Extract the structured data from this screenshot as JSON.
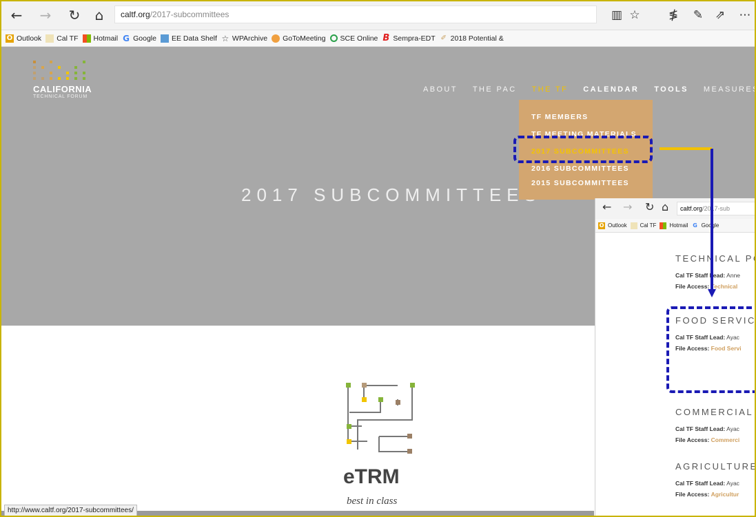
{
  "browser": {
    "url_host": "caltf.org",
    "url_path": "/2017-subcommittees",
    "icons": [
      "back-arrow-icon",
      "forward-arrow-icon",
      "refresh-icon",
      "home-icon",
      "reading-view-icon",
      "favorite-star-icon",
      "favorites-list-icon",
      "pen-icon",
      "share-icon",
      "more-icon"
    ]
  },
  "favorites": [
    "Outlook",
    "Cal TF",
    "Hotmail",
    "Google",
    "EE Data Shelf",
    "WPArchive",
    "GoToMeeting",
    "SCE Online",
    "Sempra-EDT",
    "2018 Potential &"
  ],
  "site": {
    "logo_name": "CALIFORNIA",
    "logo_sub": "TECHNICAL FORUM",
    "menu": [
      "ABOUT",
      "THE PAC",
      "THE TF",
      "CALENDAR",
      "TOOLS",
      "MEASURES"
    ],
    "dropdown": [
      "TF MEMBERS",
      "TF MEETING MATERIALS",
      "2017 SUBCOMMITTEES",
      "2016 SUBCOMMITTEES",
      "2015 SUBCOMMITTEES"
    ],
    "hero_title": "2017 SUBCOMMITTEES",
    "etrm_title": "eTRM",
    "etrm_tagline": "best in class"
  },
  "status_url": "http://www.caltf.org/2017-subcommittees/",
  "inset": {
    "url_host": "caltf.org",
    "url_path": "/2017-sub",
    "favorites": [
      "Outlook",
      "Cal TF",
      "Hotmail",
      "Google"
    ],
    "sections": [
      {
        "heading": "TECHNICAL PO",
        "lead_label": "Cal TF Staff Lead:",
        "lead_value": "Anne",
        "access_label": "File Access:",
        "access_value": "Technical"
      },
      {
        "heading": "FOOD SERVICE",
        "lead_label": "Cal TF Staff Lead:",
        "lead_value": "Ayac",
        "access_label": "File Access:",
        "access_value": "Food Servi"
      },
      {
        "heading": "COMMERCIAL",
        "lead_label": "Cal TF Staff Lead:",
        "lead_value": "Ayac",
        "access_label": "File Access:",
        "access_value": "Commerci"
      },
      {
        "heading": "AGRICULTURE",
        "lead_label": "Cal TF Staff Lead:",
        "lead_value": "Ayac",
        "access_label": "File Access:",
        "access_value": "Agricultur"
      }
    ]
  },
  "colors": {
    "hero_bg": "#a8a8a8",
    "dropdown_bg": "#d3a670",
    "active": "#f2c100",
    "annotation": "#1a1ab4",
    "connector": "#f2c100"
  }
}
